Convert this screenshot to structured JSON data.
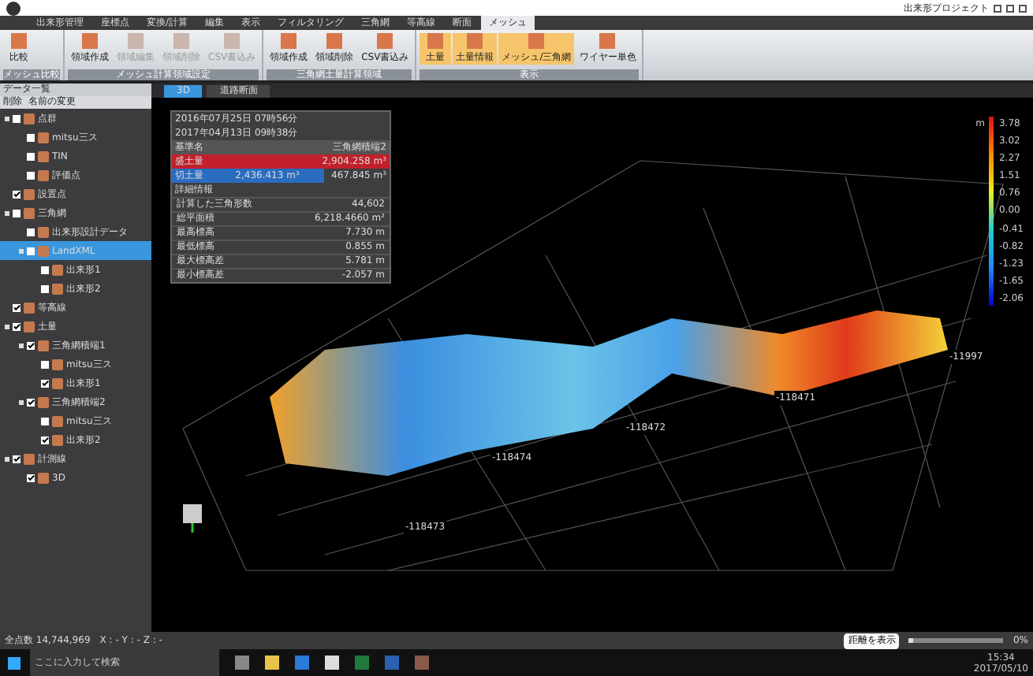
{
  "window": {
    "title": "出来形プロジェクト"
  },
  "ribbon_tabs": [
    {
      "label": "出来形管理",
      "selected": false
    },
    {
      "label": "座標点",
      "selected": false
    },
    {
      "label": "変換/計算",
      "selected": false
    },
    {
      "label": "編集",
      "selected": false
    },
    {
      "label": "表示",
      "selected": false
    },
    {
      "label": "フィルタリング",
      "selected": false
    },
    {
      "label": "三角網",
      "selected": false
    },
    {
      "label": "等高線",
      "selected": false
    },
    {
      "label": "断面",
      "selected": false
    },
    {
      "label": "メッシュ",
      "selected": true
    }
  ],
  "ribbon_groups": [
    {
      "label": "メッシュ比較",
      "buttons": [
        {
          "label": "比較",
          "disabled": false,
          "selected": false
        }
      ]
    },
    {
      "label": "メッシュ計算領域設定",
      "buttons": [
        {
          "label": "領域作成",
          "disabled": false,
          "selected": false
        },
        {
          "label": "領域編集",
          "disabled": true,
          "selected": false
        },
        {
          "label": "領域削除",
          "disabled": true,
          "selected": false
        },
        {
          "label": "CSV書込み",
          "disabled": true,
          "selected": false
        }
      ]
    },
    {
      "label": "三角網土量計算領域",
      "buttons": [
        {
          "label": "領域作成",
          "disabled": false,
          "selected": false
        },
        {
          "label": "領域削除",
          "disabled": false,
          "selected": false
        },
        {
          "label": "CSV書込み",
          "disabled": false,
          "selected": false
        }
      ]
    },
    {
      "label": "表示",
      "buttons": [
        {
          "label": "土量",
          "disabled": false,
          "selected": true
        },
        {
          "label": "土量情報",
          "disabled": false,
          "selected": true
        },
        {
          "label": "メッシュ/三角網",
          "disabled": false,
          "selected": true
        },
        {
          "label": "ワイヤー単色",
          "disabled": false,
          "selected": false
        }
      ]
    }
  ],
  "data_panel": {
    "title": "データ一覧",
    "actions": [
      "削除",
      "名前の変更"
    ],
    "tree": [
      {
        "label": "点群",
        "checked": false,
        "expanded": true,
        "selected": false,
        "children": [
          {
            "label": "mitsu三ス",
            "checked": false,
            "selected": false
          },
          {
            "label": "TIN",
            "checked": false,
            "selected": false
          },
          {
            "label": "評価点",
            "checked": false,
            "selected": false
          }
        ]
      },
      {
        "label": "設置点",
        "checked": true,
        "selected": false
      },
      {
        "label": "三角網",
        "checked": false,
        "expanded": true,
        "selected": false,
        "children": [
          {
            "label": "出来形設計データ",
            "checked": false,
            "selected": false
          },
          {
            "label": "LandXML",
            "checked": false,
            "expanded": true,
            "selected": true,
            "children": [
              {
                "label": "出来形1",
                "checked": false,
                "selected": false
              },
              {
                "label": "出来形2",
                "checked": false,
                "selected": false
              }
            ]
          }
        ]
      },
      {
        "label": "等高線",
        "checked": true,
        "selected": false
      },
      {
        "label": "土量",
        "checked": true,
        "expanded": true,
        "selected": false,
        "children": [
          {
            "label": "三角網積端1",
            "checked": true,
            "expanded": true,
            "selected": false,
            "children": [
              {
                "label": "mitsu三ス",
                "checked": false,
                "selected": false
              },
              {
                "label": "出来形1",
                "checked": true,
                "selected": false
              }
            ]
          },
          {
            "label": "三角網積端2",
            "checked": true,
            "expanded": true,
            "selected": false,
            "children": [
              {
                "label": "mitsu三ス",
                "checked": false,
                "selected": false
              },
              {
                "label": "出来形2",
                "checked": true,
                "selected": false
              }
            ]
          }
        ]
      },
      {
        "label": "計測線",
        "checked": true,
        "expanded": true,
        "selected": false,
        "children": [
          {
            "label": "3D",
            "checked": true,
            "selected": false
          }
        ]
      }
    ]
  },
  "view_tabs": [
    {
      "label": "3D",
      "selected": true
    },
    {
      "label": "道路断面",
      "selected": false
    }
  ],
  "volume_info": {
    "date_1": "2016年07月25日 07時56分",
    "date_2": "2017年04月13日 09時38分",
    "name_label": "基準名",
    "name_value": "三角網積端2",
    "fill_label": "盛土量",
    "fill_value": "2,904.258 m³",
    "cut_label": "切土量",
    "cut_value": "2,436.413 m³",
    "net_value": "467.845 m³",
    "details_title": "詳細情報",
    "details": [
      {
        "label": "計算した三角形数",
        "value": "44,602"
      },
      {
        "label": "総平面積",
        "value": "6,218.4660 m²"
      },
      {
        "label": "最高標高",
        "value": "7.730 m"
      },
      {
        "label": "最低標高",
        "value": "0.855 m"
      },
      {
        "label": "最大標高差",
        "value": "5.781 m"
      },
      {
        "label": "最小標高差",
        "value": "-2.057 m"
      }
    ]
  },
  "grid_labels": [
    "-118474",
    "-118473",
    "-118472",
    "-118471",
    "-11997"
  ],
  "color_scale": {
    "unit": "m",
    "labels": [
      "3.78",
      "3.02",
      "2.27",
      "1.51",
      "0.76",
      "0.00",
      "-0.41",
      "-0.82",
      "-1.23",
      "-1.65",
      "-2.06"
    ]
  },
  "status_bar": {
    "total_points": "全点数 14,744,969",
    "coords": "X : -  Y : -  Z : -",
    "distance_button": "距離を表示",
    "zoom": "0%",
    "level": 0.05
  },
  "taskbar": {
    "search_placeholder": "ここに入力して検索",
    "time": "15:34",
    "date": "2017/05/10"
  }
}
